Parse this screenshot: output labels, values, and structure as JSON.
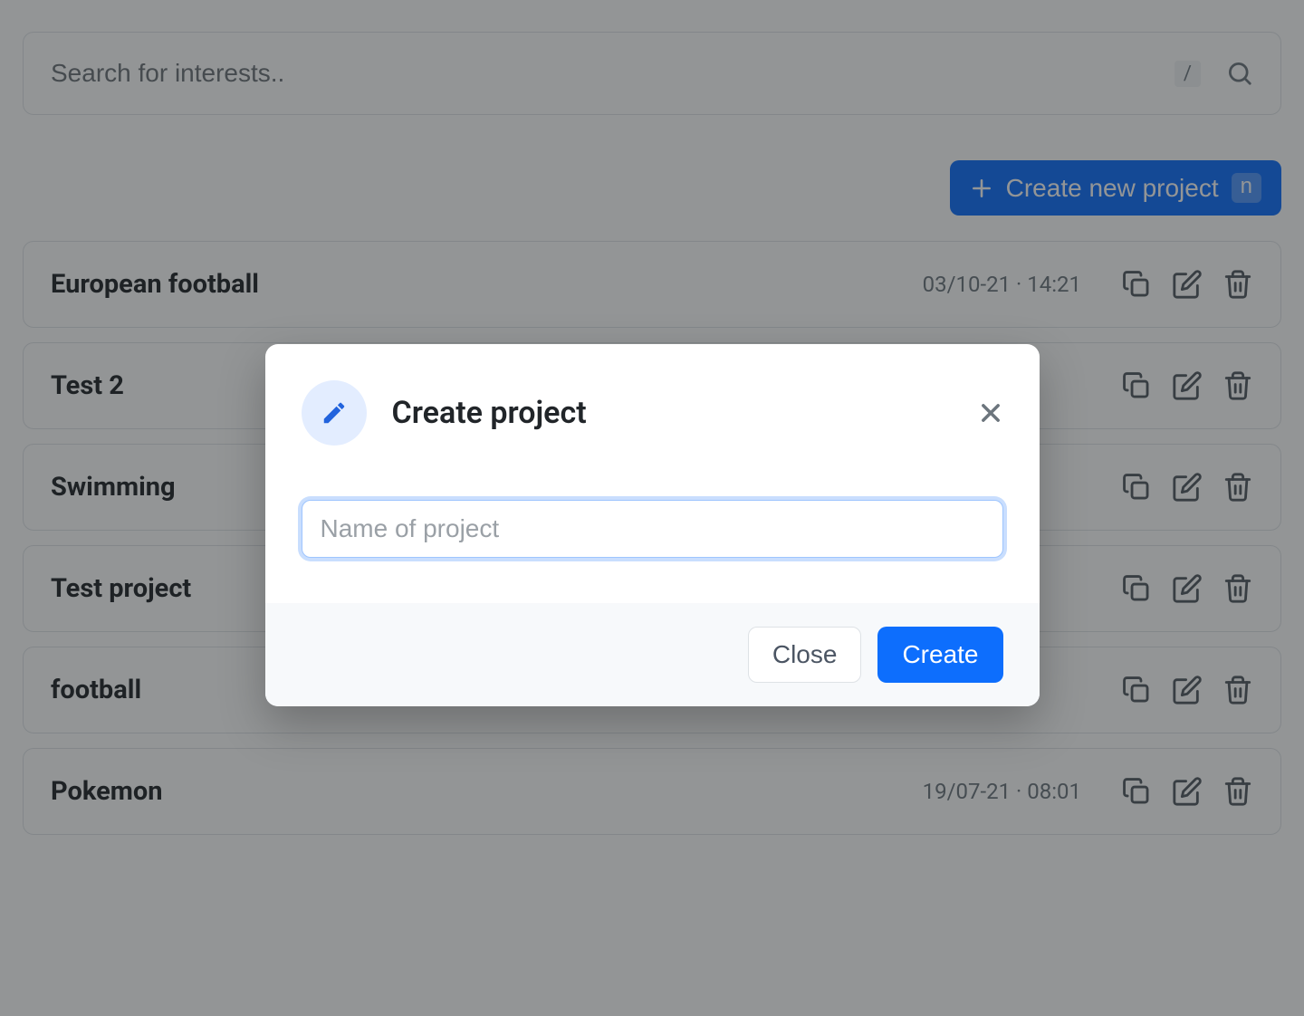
{
  "search": {
    "placeholder": "Search for interests..",
    "kbd": "/"
  },
  "toolbar": {
    "create_label": "Create new project",
    "create_kbd": "n"
  },
  "projects": [
    {
      "name": "European football",
      "date": "03/10-21 · 14:21"
    },
    {
      "name": "Test 2",
      "date": ""
    },
    {
      "name": "Swimming",
      "date": ""
    },
    {
      "name": "Test project",
      "date": ""
    },
    {
      "name": "football",
      "date": ""
    },
    {
      "name": "Pokemon",
      "date": "19/07-21 · 08:01"
    }
  ],
  "modal": {
    "title": "Create project",
    "input_placeholder": "Name of project",
    "close_label": "Close",
    "create_label": "Create"
  }
}
